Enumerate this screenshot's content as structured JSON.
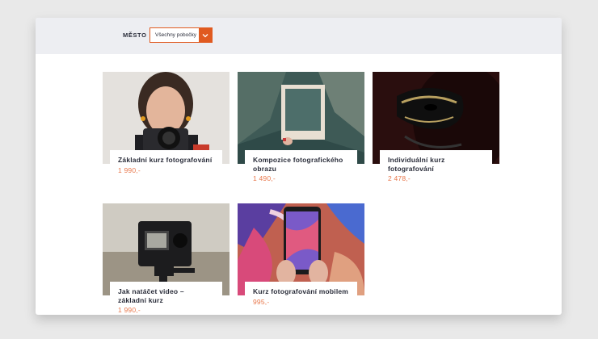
{
  "filter": {
    "city_label": "MĚSTO",
    "city_selected": "Všechny pobočky"
  },
  "colors": {
    "accent": "#e05a20",
    "price": "#e8764a",
    "text": "#2a2d3a",
    "filter_bar": "#edeef2"
  },
  "products": [
    {
      "title": "Základní kurz fotografování",
      "price": "1 990,-",
      "image_icon": "woman-with-camera-photo"
    },
    {
      "title": "Kompozice fotografického obrazu",
      "price": "1 490,-",
      "image_icon": "polaroid-frame-landscape-photo"
    },
    {
      "title": "Individuální kurz fotografování",
      "price": "2 478,-",
      "image_icon": "carnival-mask-photo"
    },
    {
      "title": "Jak natáčet video – základní kurz",
      "price": "1 990,-",
      "image_icon": "action-camera-photo"
    },
    {
      "title": "Kurz fotografování mobilem",
      "price": "995,-",
      "image_icon": "smartphone-photo"
    }
  ]
}
